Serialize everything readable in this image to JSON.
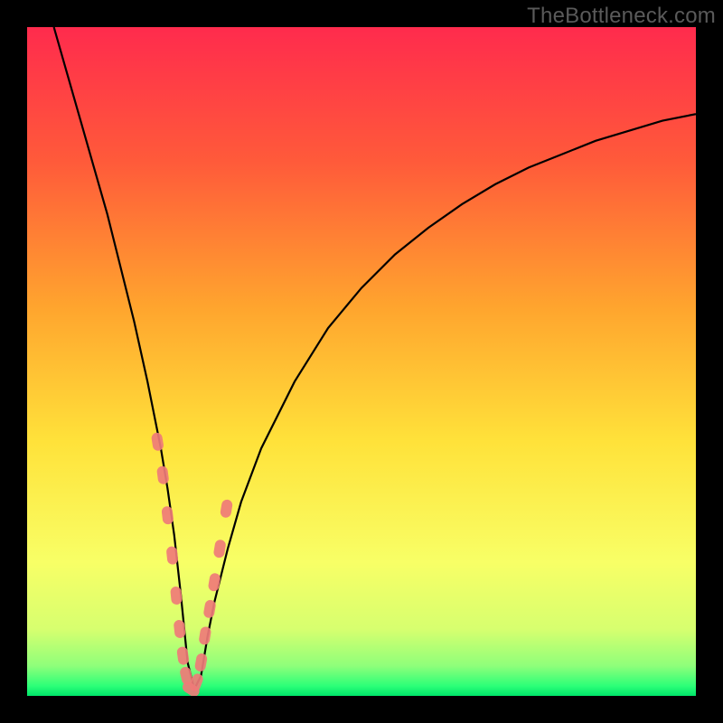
{
  "watermark": "TheBottleneck.com",
  "chart_data": {
    "type": "line",
    "title": "",
    "xlabel": "",
    "ylabel": "",
    "xlim": [
      0,
      100
    ],
    "ylim": [
      0,
      100
    ],
    "curve": {
      "name": "bottleneck-curve",
      "x": [
        4,
        6,
        8,
        10,
        12,
        14,
        16,
        18,
        20,
        21,
        22,
        23,
        24,
        25,
        26,
        27,
        28,
        30,
        32,
        35,
        40,
        45,
        50,
        55,
        60,
        65,
        70,
        75,
        80,
        85,
        90,
        95,
        100
      ],
      "y": [
        100,
        93,
        86,
        79,
        72,
        64,
        56,
        47,
        37,
        31,
        24,
        15,
        5,
        1,
        3,
        9,
        14,
        22,
        29,
        37,
        47,
        55,
        61,
        66,
        70,
        73.5,
        76.5,
        79,
        81,
        83,
        84.5,
        86,
        87
      ]
    },
    "markers": {
      "name": "highlight-dots",
      "x": [
        19.5,
        20.3,
        21.0,
        21.7,
        22.3,
        22.8,
        23.3,
        23.8,
        24.5,
        25.3,
        26.0,
        26.6,
        27.3,
        28.0,
        28.8,
        29.8
      ],
      "y": [
        38,
        33,
        27,
        21,
        15,
        10,
        6,
        3,
        1,
        2,
        5,
        9,
        13,
        17,
        22,
        28
      ]
    },
    "gradient_stops": [
      {
        "offset": 0.0,
        "color": "#ff2b4d"
      },
      {
        "offset": 0.2,
        "color": "#ff5a3a"
      },
      {
        "offset": 0.42,
        "color": "#ffa52e"
      },
      {
        "offset": 0.62,
        "color": "#ffe23a"
      },
      {
        "offset": 0.8,
        "color": "#f8ff66"
      },
      {
        "offset": 0.9,
        "color": "#d7ff6f"
      },
      {
        "offset": 0.955,
        "color": "#8fff7a"
      },
      {
        "offset": 0.985,
        "color": "#2dff78"
      },
      {
        "offset": 1.0,
        "color": "#00e56a"
      }
    ]
  }
}
